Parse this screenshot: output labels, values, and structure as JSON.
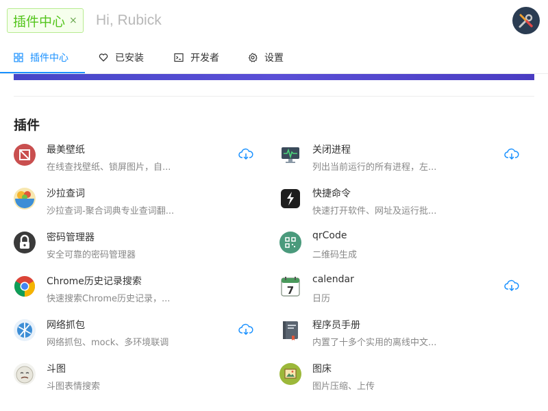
{
  "search": {
    "tag_label": "插件中心",
    "tag_close": "×",
    "placeholder": "Hi, Rubick"
  },
  "tabs": [
    {
      "label": "插件中心",
      "icon": "grid-icon",
      "active": true
    },
    {
      "label": "已安装",
      "icon": "heart-icon",
      "active": false
    },
    {
      "label": "开发者",
      "icon": "terminal-icon",
      "active": false
    },
    {
      "label": "设置",
      "icon": "gear-icon",
      "active": false
    }
  ],
  "section_title": "插件",
  "plugins": [
    {
      "name": "最美壁纸",
      "desc": "在线查找壁纸、锁屏图片，自...",
      "icon": "wallpaper-icon",
      "download": true
    },
    {
      "name": "关闭进程",
      "desc": "列出当前运行的所有进程，左...",
      "icon": "monitor-icon",
      "download": true
    },
    {
      "name": "沙拉查词",
      "desc": "沙拉查词-聚合词典专业查词翻...",
      "icon": "salad-icon",
      "download": false
    },
    {
      "name": "快捷命令",
      "desc": "快速打开软件、网址及运行批...",
      "icon": "bolt-icon",
      "download": false
    },
    {
      "name": "密码管理器",
      "desc": "安全可靠的密码管理器",
      "icon": "lock-icon",
      "download": false
    },
    {
      "name": "qrCode",
      "desc": "二维码生成",
      "icon": "qrcode-icon",
      "download": false
    },
    {
      "name": "Chrome历史记录搜索",
      "desc": "快速搜索Chrome历史记录，...",
      "icon": "chrome-icon",
      "download": false
    },
    {
      "name": "calendar",
      "desc": "日历",
      "icon": "calendar-icon",
      "calendar_day": "7",
      "download": true
    },
    {
      "name": "网络抓包",
      "desc": "网络抓包、mock、多环境联调",
      "icon": "network-icon",
      "download": true
    },
    {
      "name": "程序员手册",
      "desc": "内置了十多个实用的离线中文...",
      "icon": "book-icon",
      "download": false
    },
    {
      "name": "斗图",
      "desc": "斗图表情搜索",
      "icon": "meme-face-icon",
      "download": false
    },
    {
      "name": "图床",
      "desc": "图片压缩、上传",
      "icon": "image-frame-icon",
      "download": false
    }
  ],
  "colors": {
    "accent": "#1890ff",
    "tag_green": "#52c41a",
    "download_icon": "#1890ff"
  }
}
